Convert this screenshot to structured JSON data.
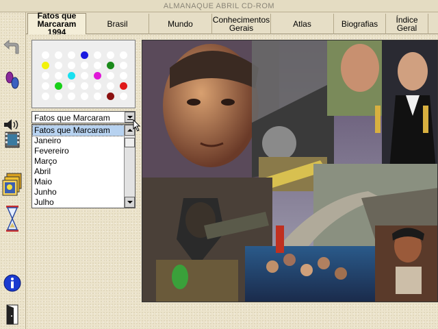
{
  "window": {
    "title": "ALMANAQUE ABRIL CD-ROM"
  },
  "tabs": [
    {
      "label": "Fatos que Marcaram 1994",
      "active": true
    },
    {
      "label": "Brasil",
      "active": false
    },
    {
      "label": "Mundo",
      "active": false
    },
    {
      "label": "Conhecimentos Gerais",
      "active": false
    },
    {
      "label": "Atlas",
      "active": false
    },
    {
      "label": "Biografias",
      "active": false
    },
    {
      "label": "Índice Geral",
      "active": false
    }
  ],
  "sidebar": {
    "icons": [
      "undo-arrow-icon",
      "footsteps-icon",
      "speaker-film-icon",
      "photo-slides-icon",
      "hourglass-icon",
      "info-icon",
      "exit-door-icon"
    ]
  },
  "month_selector": {
    "selected": "Fatos que Marcaram",
    "options": [
      "Fatos que Marcaram",
      "Janeiro",
      "Fevereiro",
      "Março",
      "Abril",
      "Maio",
      "Junho",
      "Julho"
    ]
  },
  "dot_grid": {
    "colors": {
      "white": "#ffffff",
      "blue": "#1a1ae0",
      "yellow": "#f2f20a",
      "cyan": "#18e0f0",
      "magenta": "#e018d8",
      "green": "#1a8a1a",
      "bright_green": "#18d018",
      "red": "#e01818",
      "dark_red": "#8a1010"
    }
  },
  "collage": {
    "description_visible": false
  }
}
